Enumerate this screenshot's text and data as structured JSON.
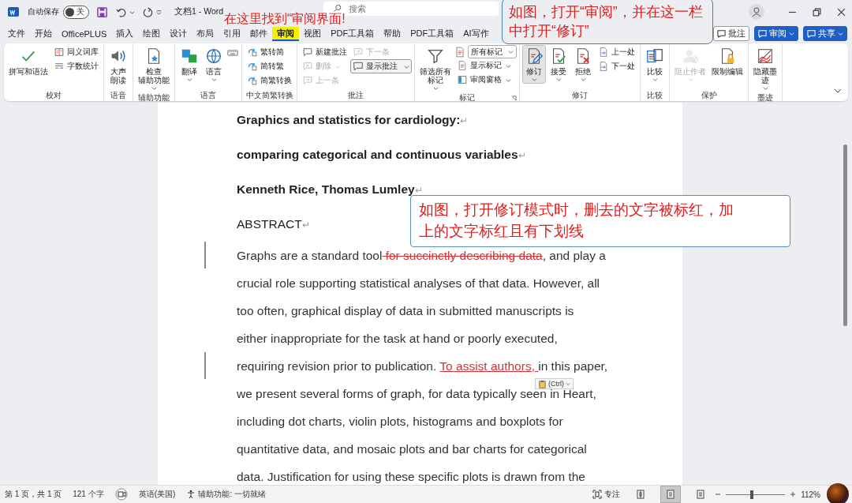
{
  "title_bar": {
    "autosave_label": "自动保存",
    "autosave_toggle": {
      "label": "关",
      "on": false
    },
    "title": "文档1 - Word",
    "search": {
      "placeholder": "搜索"
    }
  },
  "menu": {
    "tabs": [
      {
        "label": "文件",
        "selected": false,
        "highlighted": false
      },
      {
        "label": "开始",
        "selected": false,
        "highlighted": false
      },
      {
        "label": "OfficePLUS",
        "selected": false,
        "highlighted": false
      },
      {
        "label": "插入",
        "selected": false,
        "highlighted": false
      },
      {
        "label": "绘图",
        "selected": false,
        "highlighted": false
      },
      {
        "label": "设计",
        "selected": false,
        "highlighted": false
      },
      {
        "label": "布局",
        "selected": false,
        "highlighted": false
      },
      {
        "label": "引用",
        "selected": false,
        "highlighted": false
      },
      {
        "label": "邮件",
        "selected": false,
        "highlighted": false
      },
      {
        "label": "审阅",
        "selected": true,
        "highlighted": true
      },
      {
        "label": "视图",
        "selected": false,
        "highlighted": false
      },
      {
        "label": "PDF工具箱",
        "selected": false,
        "highlighted": false
      },
      {
        "label": "帮助",
        "selected": false,
        "highlighted": false
      },
      {
        "label": "PDF工具箱",
        "selected": false,
        "highlighted": false
      },
      {
        "label": "AI写作",
        "selected": false,
        "highlighted": false
      }
    ],
    "buttons": [
      {
        "label": "批注",
        "kind": "outline",
        "caret": false
      },
      {
        "label": "审阅",
        "kind": "primary",
        "caret": true
      },
      {
        "label": "共享",
        "kind": "primary",
        "caret": true
      }
    ]
  },
  "ribbon": {
    "groups": [
      {
        "label": "校对",
        "launcher": false,
        "columns": [
          [
            {
              "kind": "large",
              "label": [
                "拼写和语法"
              ],
              "caret": false,
              "disabled": false,
              "pressed": false
            }
          ],
          [
            {
              "kind": "small",
              "label": "同义词库",
              "caret": false,
              "disabled": false
            },
            {
              "kind": "small",
              "label": "字数统计",
              "caret": false,
              "disabled": false
            }
          ]
        ]
      },
      {
        "label": "语音",
        "launcher": false,
        "columns": [
          [
            {
              "kind": "large",
              "label": [
                "大声",
                "朗读"
              ],
              "caret": false,
              "disabled": false,
              "pressed": false
            }
          ]
        ]
      },
      {
        "label": "辅助功能",
        "launcher": false,
        "columns": [
          [
            {
              "kind": "large",
              "label": [
                "检查",
                "辅助功能"
              ],
              "caret": true,
              "disabled": false,
              "pressed": false
            }
          ]
        ]
      },
      {
        "label": "语言",
        "launcher": false,
        "columns": [
          [
            {
              "kind": "large",
              "label": [
                "翻译"
              ],
              "caret": true,
              "disabled": false,
              "pressed": false
            }
          ],
          [
            {
              "kind": "large",
              "label": [
                "语言"
              ],
              "caret": true,
              "disabled": false,
              "pressed": false
            }
          ],
          [
            {
              "kind": "icon",
              "caret": false,
              "disabled": false
            }
          ]
        ]
      },
      {
        "label": "中文简繁转换",
        "launcher": false,
        "columns": [
          [
            {
              "kind": "small",
              "label": "繁转简",
              "caret": false,
              "disabled": false
            },
            {
              "kind": "small",
              "label": "简转繁",
              "caret": false,
              "disabled": false
            },
            {
              "kind": "small",
              "label": "简繁转换",
              "caret": false,
              "disabled": false
            }
          ]
        ]
      },
      {
        "label": "批注",
        "launcher": false,
        "columns": [
          [
            {
              "kind": "small",
              "label": "新建批注",
              "caret": false,
              "disabled": false
            },
            {
              "kind": "small",
              "label": "删除",
              "caret": true,
              "disabled": true
            },
            {
              "kind": "small",
              "label": "上一条",
              "caret": false,
              "disabled": true
            }
          ],
          [
            {
              "kind": "small",
              "label": "下一条",
              "caret": false,
              "disabled": true
            },
            {
              "kind": "boxed",
              "label": "显示批注",
              "caret": true,
              "disabled": false
            }
          ]
        ]
      },
      {
        "label": "标记",
        "launcher": true,
        "columns": [
          [
            {
              "kind": "large",
              "label": [
                "筛选所有",
                "标记"
              ],
              "caret": true,
              "disabled": false,
              "pressed": false
            }
          ],
          [
            {
              "kind": "select",
              "label": "所有标记",
              "caret": true,
              "disabled": false
            },
            {
              "kind": "small",
              "label": "显示标记",
              "caret": true,
              "disabled": false
            },
            {
              "kind": "small",
              "label": "审阅窗格",
              "caret": true,
              "disabled": false
            }
          ]
        ]
      },
      {
        "label": "修订",
        "launcher": false,
        "columns": [
          [
            {
              "kind": "large",
              "label": [
                "修订"
              ],
              "caret": true,
              "disabled": false,
              "pressed": true
            }
          ],
          [
            {
              "kind": "large",
              "label": [
                "接受"
              ],
              "caret": true,
              "disabled": false,
              "pressed": false
            }
          ],
          [
            {
              "kind": "large",
              "label": [
                "拒绝"
              ],
              "caret": true,
              "disabled": false,
              "pressed": false
            }
          ],
          [
            {
              "kind": "small",
              "label": "上一处",
              "caret": false,
              "disabled": false
            },
            {
              "kind": "small",
              "label": "下一处",
              "caret": false,
              "disabled": false
            }
          ]
        ]
      },
      {
        "label": "比较",
        "launcher": false,
        "columns": [
          [
            {
              "kind": "large",
              "label": [
                "比较"
              ],
              "caret": true,
              "disabled": false,
              "pressed": false
            }
          ]
        ]
      },
      {
        "label": "保护",
        "launcher": false,
        "columns": [
          [
            {
              "kind": "large",
              "label": [
                "阻止作者"
              ],
              "caret": true,
              "disabled": true,
              "pressed": false
            }
          ],
          [
            {
              "kind": "large",
              "label": [
                "限制编辑"
              ],
              "caret": false,
              "disabled": false,
              "pressed": false
            }
          ]
        ]
      },
      {
        "label": "墨迹",
        "launcher": false,
        "columns": [
          [
            {
              "kind": "large",
              "label": [
                "隐藏墨",
                "迹"
              ],
              "caret": true,
              "disabled": false,
              "pressed": false
            }
          ]
        ]
      }
    ]
  },
  "document": {
    "headings": [
      {
        "text": "Graphics and statistics for cardiology:",
        "bold": true,
        "mark": "↵"
      },
      {
        "text": "comparing categorical and continuous variables",
        "bold": true,
        "mark": "↵"
      },
      {
        "text": "Kenneth Rice, Thomas Lumley",
        "bold": true,
        "mark": "↵"
      },
      {
        "text": "ABSTRACT",
        "bold": false,
        "mark": "↵"
      }
    ],
    "lines": [
      {
        "change_bar": true,
        "segments": [
          {
            "kind": "text",
            "text": "Graphs are a standard tool"
          },
          {
            "kind": "deleted",
            "text": " for succinctly describing data"
          },
          {
            "kind": "text",
            "text": ", and play a"
          }
        ]
      },
      {
        "change_bar": false,
        "segments": [
          {
            "kind": "text",
            "text": "crucial role supporting statistical analyses of that data. However, all"
          }
        ]
      },
      {
        "change_bar": false,
        "segments": [
          {
            "kind": "text",
            "text": "too often, graphical display of data in submitted manuscripts is"
          }
        ]
      },
      {
        "change_bar": false,
        "segments": [
          {
            "kind": "text",
            "text": "either inappropriate for the task at hand or poorly executed,"
          }
        ]
      },
      {
        "change_bar": true,
        "segments": [
          {
            "kind": "text",
            "text": "requiring revision prior to publication. "
          },
          {
            "kind": "inserted",
            "text": "To assist authors, "
          },
          {
            "kind": "text",
            "text": "in this paper,"
          }
        ]
      },
      {
        "change_bar": false,
        "segments": [
          {
            "kind": "text",
            "text": "we present several forms of graph, for data typically seen in Heart,"
          }
        ]
      },
      {
        "change_bar": false,
        "segments": [
          {
            "kind": "text",
            "text": "including dot charts, violin plots, histograms and boxplots for"
          }
        ]
      },
      {
        "change_bar": false,
        "segments": [
          {
            "kind": "text",
            "text": "quantitative data, and mosaic plots and bar charts for categorical"
          }
        ]
      },
      {
        "change_bar": false,
        "segments": [
          {
            "kind": "text",
            "text": "data. Justification for using these specific plots is drawn from the"
          }
        ]
      }
    ],
    "paste_options": {
      "label": "(Ctrl)"
    }
  },
  "annotations": [
    {
      "kind": "title_note",
      "lines": [
        "在这里找到“审阅界面!"
      ]
    },
    {
      "kind": "boxed_note",
      "lines": [
        "如图，打开“审阅”，并在这一栏",
        "中打开“修订”"
      ]
    },
    {
      "kind": "callout",
      "lines": [
        "如图，打开修订模式时，删去的文字被标红，加",
        "上的文字标红且有下划线"
      ]
    }
  ],
  "status_bar": {
    "page": "第 1 页，共 1 页",
    "words": "121 个字",
    "language": "英语(美国)",
    "accessibility": "辅助功能: 一切就绪",
    "focus": "专注",
    "views": [
      {
        "selected": false
      },
      {
        "selected": true
      },
      {
        "selected": false
      }
    ],
    "zoom": {
      "level": 0.44,
      "reading": "112%"
    }
  }
}
